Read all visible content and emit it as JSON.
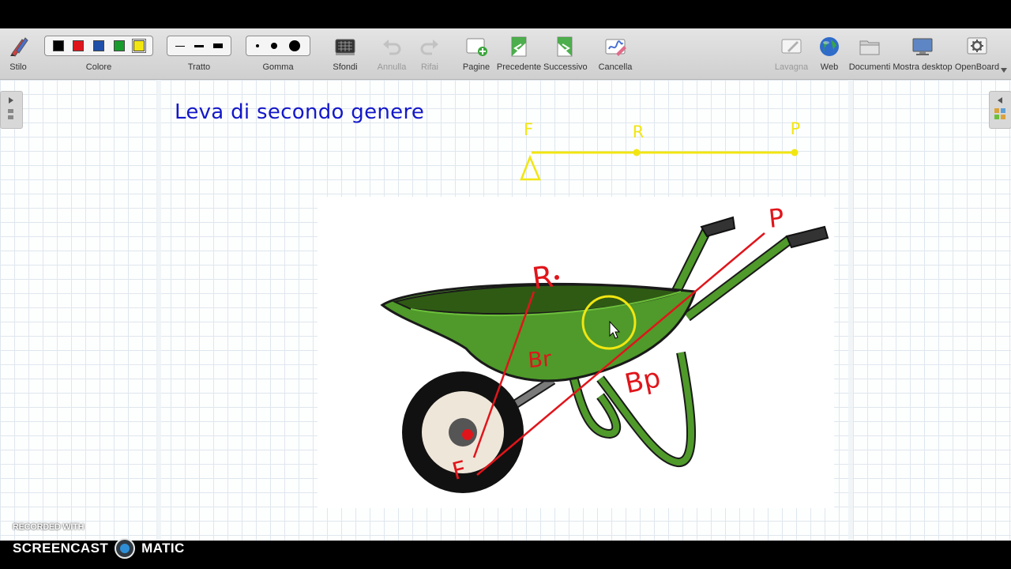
{
  "toolbar": {
    "stylus_label": "Stilo",
    "color_label": "Colore",
    "colors": [
      "#000000",
      "#e0151b",
      "#1f4fa8",
      "#189c2c",
      "#f2e611"
    ],
    "stroke_label": "Tratto",
    "eraser_label": "Gomma",
    "backgrounds_label": "Sfondi",
    "undo_label": "Annulla",
    "redo_label": "Rifai",
    "pages_label": "Pagine",
    "previous_label": "Precedente",
    "next_label": "Successivo",
    "clear_label": "Cancella",
    "board_label": "Lavagna",
    "web_label": "Web",
    "documents_label": "Documenti",
    "desktop_label": "Mostra desktop",
    "openboard_label": "OpenBoard"
  },
  "page": {
    "title": "Leva di secondo genere"
  },
  "annotations": {
    "lever_f": "F",
    "lever_r": "R",
    "lever_p": "P",
    "wheel_f": "F",
    "wheel_r": "R",
    "wheel_p": "P",
    "arm_r": "Br",
    "arm_p": "Bp",
    "annotation_color": "#e0151b",
    "lever_color": "#f2e611"
  },
  "watermark": {
    "small": "RECORDED WITH",
    "brand_left": "SCREENCAST",
    "brand_right": "MATIC"
  }
}
